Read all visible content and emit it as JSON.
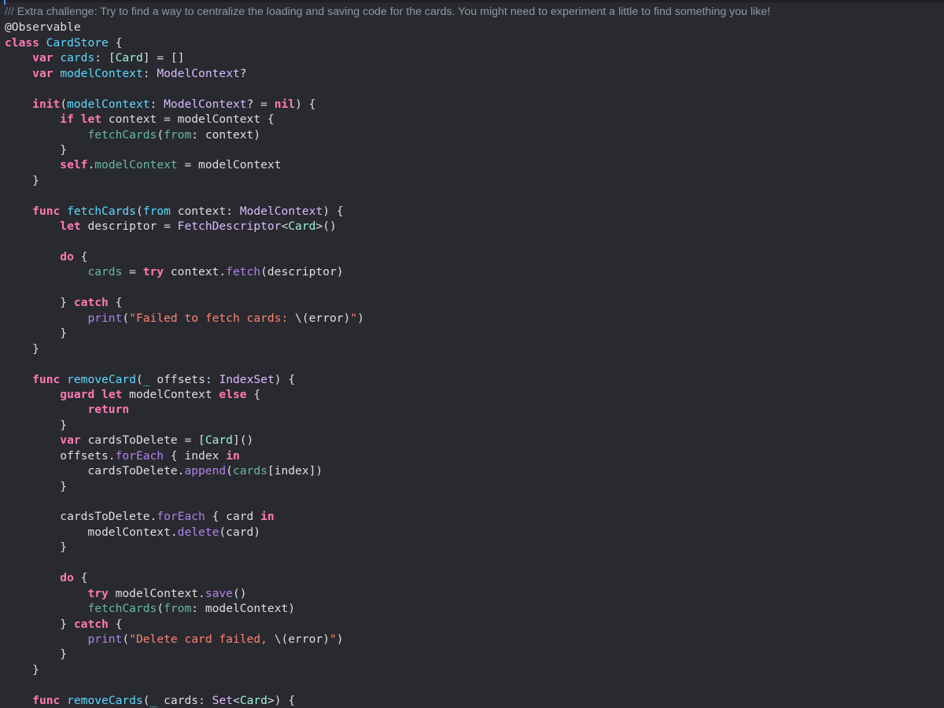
{
  "editor": {
    "colors": {
      "background": "#292a30",
      "keyword": "#ff7ab2",
      "type": "#dabaff",
      "declaration": "#5dd8ff",
      "project_type": "#9ef1dd",
      "function": "#67b7a4",
      "method": "#b281eb",
      "string": "#ff8170",
      "comment": "#8e98a4",
      "plain": "#dfdfe0"
    },
    "lines": [
      [
        [
          "doc-slash",
          "/// "
        ],
        [
          "doc",
          "Extra challenge: Try to find a way to centralize the loading and saving code for the cards. You might need to experiment a little to find something you like!"
        ]
      ],
      [
        [
          "plain",
          "@Observable"
        ]
      ],
      [
        [
          "kw",
          "class"
        ],
        [
          "plain",
          " "
        ],
        [
          "tdecl",
          "CardStore"
        ],
        [
          "plain",
          " {"
        ]
      ],
      [
        [
          "plain",
          "    "
        ],
        [
          "kw",
          "var"
        ],
        [
          "plain",
          " "
        ],
        [
          "tdecl",
          "cards"
        ],
        [
          "plain",
          ": ["
        ],
        [
          "tproj",
          "Card"
        ],
        [
          "plain",
          "] = []"
        ]
      ],
      [
        [
          "plain",
          "    "
        ],
        [
          "kw",
          "var"
        ],
        [
          "plain",
          " "
        ],
        [
          "tdecl",
          "modelContext"
        ],
        [
          "plain",
          ": "
        ],
        [
          "type",
          "ModelContext"
        ],
        [
          "plain",
          "?"
        ]
      ],
      [],
      [
        [
          "plain",
          "    "
        ],
        [
          "kw",
          "init"
        ],
        [
          "plain",
          "("
        ],
        [
          "tdecl",
          "modelContext"
        ],
        [
          "plain",
          ": "
        ],
        [
          "type",
          "ModelContext"
        ],
        [
          "plain",
          "? = "
        ],
        [
          "kw",
          "nil"
        ],
        [
          "plain",
          ") {"
        ]
      ],
      [
        [
          "plain",
          "        "
        ],
        [
          "kw",
          "if"
        ],
        [
          "plain",
          " "
        ],
        [
          "kw",
          "let"
        ],
        [
          "plain",
          " context = modelContext {"
        ]
      ],
      [
        [
          "plain",
          "            "
        ],
        [
          "fn",
          "fetchCards"
        ],
        [
          "plain",
          "("
        ],
        [
          "fn",
          "from"
        ],
        [
          "plain",
          ": context)"
        ]
      ],
      [
        [
          "plain",
          "        }"
        ]
      ],
      [
        [
          "plain",
          "        "
        ],
        [
          "kw",
          "self"
        ],
        [
          "plain",
          "."
        ],
        [
          "fn",
          "modelContext"
        ],
        [
          "plain",
          " = modelContext"
        ]
      ],
      [
        [
          "plain",
          "    }"
        ]
      ],
      [],
      [
        [
          "plain",
          "    "
        ],
        [
          "kw",
          "func"
        ],
        [
          "plain",
          " "
        ],
        [
          "tdecl",
          "fetchCards"
        ],
        [
          "plain",
          "("
        ],
        [
          "tdecl",
          "from"
        ],
        [
          "plain",
          " context: "
        ],
        [
          "type",
          "ModelContext"
        ],
        [
          "plain",
          ") {"
        ]
      ],
      [
        [
          "plain",
          "        "
        ],
        [
          "kw",
          "let"
        ],
        [
          "plain",
          " descriptor = "
        ],
        [
          "type",
          "FetchDescriptor"
        ],
        [
          "plain",
          "<"
        ],
        [
          "tproj",
          "Card"
        ],
        [
          "plain",
          ">()"
        ]
      ],
      [],
      [
        [
          "plain",
          "        "
        ],
        [
          "kw",
          "do"
        ],
        [
          "plain",
          " {"
        ]
      ],
      [
        [
          "plain",
          "            "
        ],
        [
          "fn",
          "cards"
        ],
        [
          "plain",
          " = "
        ],
        [
          "kw",
          "try"
        ],
        [
          "plain",
          " context."
        ],
        [
          "meth",
          "fetch"
        ],
        [
          "plain",
          "(descriptor)"
        ]
      ],
      [],
      [
        [
          "plain",
          "        } "
        ],
        [
          "kw",
          "catch"
        ],
        [
          "plain",
          " {"
        ]
      ],
      [
        [
          "plain",
          "            "
        ],
        [
          "meth",
          "print"
        ],
        [
          "plain",
          "("
        ],
        [
          "str",
          "\"Failed to fetch cards: "
        ],
        [
          "plain",
          "\\(error)"
        ],
        [
          "str",
          "\""
        ],
        [
          "plain",
          ")"
        ]
      ],
      [
        [
          "plain",
          "        }"
        ]
      ],
      [
        [
          "plain",
          "    }"
        ]
      ],
      [],
      [
        [
          "plain",
          "    "
        ],
        [
          "kw",
          "func"
        ],
        [
          "plain",
          " "
        ],
        [
          "tdecl",
          "removeCard"
        ],
        [
          "plain",
          "("
        ],
        [
          "tdecl",
          "_"
        ],
        [
          "plain",
          " offsets: "
        ],
        [
          "type",
          "IndexSet"
        ],
        [
          "plain",
          ") {"
        ]
      ],
      [
        [
          "plain",
          "        "
        ],
        [
          "kw",
          "guard"
        ],
        [
          "plain",
          " "
        ],
        [
          "kw",
          "let"
        ],
        [
          "plain",
          " modelContext "
        ],
        [
          "kw",
          "else"
        ],
        [
          "plain",
          " {"
        ]
      ],
      [
        [
          "plain",
          "            "
        ],
        [
          "kw",
          "return"
        ]
      ],
      [
        [
          "plain",
          "        }"
        ]
      ],
      [
        [
          "plain",
          "        "
        ],
        [
          "kw",
          "var"
        ],
        [
          "plain",
          " cardsToDelete = ["
        ],
        [
          "tproj",
          "Card"
        ],
        [
          "plain",
          "]()"
        ]
      ],
      [
        [
          "plain",
          "        offsets."
        ],
        [
          "meth",
          "forEach"
        ],
        [
          "plain",
          " { index "
        ],
        [
          "kw",
          "in"
        ]
      ],
      [
        [
          "plain",
          "            cardsToDelete."
        ],
        [
          "meth",
          "append"
        ],
        [
          "plain",
          "("
        ],
        [
          "fn",
          "cards"
        ],
        [
          "plain",
          "[index])"
        ]
      ],
      [
        [
          "plain",
          "        }"
        ]
      ],
      [],
      [
        [
          "plain",
          "        cardsToDelete."
        ],
        [
          "meth",
          "forEach"
        ],
        [
          "plain",
          " { card "
        ],
        [
          "kw",
          "in"
        ]
      ],
      [
        [
          "plain",
          "            modelContext."
        ],
        [
          "meth",
          "delete"
        ],
        [
          "plain",
          "(card)"
        ]
      ],
      [
        [
          "plain",
          "        }"
        ]
      ],
      [],
      [
        [
          "plain",
          "        "
        ],
        [
          "kw",
          "do"
        ],
        [
          "plain",
          " {"
        ]
      ],
      [
        [
          "plain",
          "            "
        ],
        [
          "kw",
          "try"
        ],
        [
          "plain",
          " modelContext."
        ],
        [
          "meth",
          "save"
        ],
        [
          "plain",
          "()"
        ]
      ],
      [
        [
          "plain",
          "            "
        ],
        [
          "fn",
          "fetchCards"
        ],
        [
          "plain",
          "("
        ],
        [
          "fn",
          "from"
        ],
        [
          "plain",
          ": modelContext)"
        ]
      ],
      [
        [
          "plain",
          "        } "
        ],
        [
          "kw",
          "catch"
        ],
        [
          "plain",
          " {"
        ]
      ],
      [
        [
          "plain",
          "            "
        ],
        [
          "meth",
          "print"
        ],
        [
          "plain",
          "("
        ],
        [
          "str",
          "\"Delete card failed, "
        ],
        [
          "plain",
          "\\(error)"
        ],
        [
          "str",
          "\""
        ],
        [
          "plain",
          ")"
        ]
      ],
      [
        [
          "plain",
          "        }"
        ]
      ],
      [
        [
          "plain",
          "    }"
        ]
      ],
      [],
      [
        [
          "plain",
          "    "
        ],
        [
          "kw",
          "func"
        ],
        [
          "plain",
          " "
        ],
        [
          "tdecl",
          "removeCards"
        ],
        [
          "plain",
          "("
        ],
        [
          "tdecl",
          "_"
        ],
        [
          "plain",
          " cards: "
        ],
        [
          "type",
          "Set"
        ],
        [
          "plain",
          "<"
        ],
        [
          "tproj",
          "Card"
        ],
        [
          "plain",
          ">) {"
        ]
      ]
    ]
  }
}
